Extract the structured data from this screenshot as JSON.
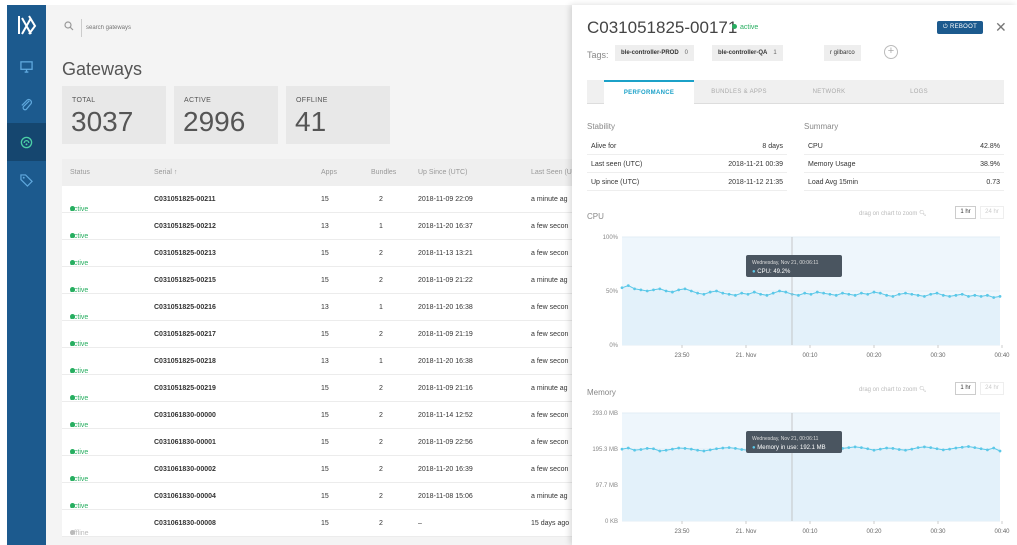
{
  "sidebar": {
    "logo": "logo-icon",
    "items": [
      {
        "icon": "monitor-icon",
        "active": false
      },
      {
        "icon": "paperclip-icon",
        "active": false
      },
      {
        "icon": "gateway-icon",
        "active": true
      },
      {
        "icon": "tag-icon",
        "active": false
      }
    ]
  },
  "search": {
    "placeholder": "search gateways",
    "value": ""
  },
  "page": {
    "title": "Gateways"
  },
  "stats": [
    {
      "label": "TOTAL",
      "value": "3037"
    },
    {
      "label": "ACTIVE",
      "value": "2996"
    },
    {
      "label": "OFFLINE",
      "value": "41"
    }
  ],
  "table": {
    "headers": {
      "status": "Status",
      "serial": "Serial ↑",
      "apps": "Apps",
      "bundles": "Bundles",
      "up_since": "Up Since (UTC)",
      "last_seen": "Last Seen (U"
    },
    "rows": [
      {
        "status": "active",
        "serial": "C031051825-00211",
        "apps": "15",
        "bundles": "2",
        "up_since": "2018-11-09 22:09",
        "last_seen": "a minute ag"
      },
      {
        "status": "active",
        "serial": "C031051825-00212",
        "apps": "13",
        "bundles": "1",
        "up_since": "2018-11-20 16:37",
        "last_seen": "a few secon"
      },
      {
        "status": "active",
        "serial": "C031051825-00213",
        "apps": "15",
        "bundles": "2",
        "up_since": "2018-11-13 13:21",
        "last_seen": "a few secon"
      },
      {
        "status": "active",
        "serial": "C031051825-00215",
        "apps": "15",
        "bundles": "2",
        "up_since": "2018-11-09 21:22",
        "last_seen": "a minute ag"
      },
      {
        "status": "active",
        "serial": "C031051825-00216",
        "apps": "13",
        "bundles": "1",
        "up_since": "2018-11-20 16:38",
        "last_seen": "a few secon"
      },
      {
        "status": "active",
        "serial": "C031051825-00217",
        "apps": "15",
        "bundles": "2",
        "up_since": "2018-11-09 21:19",
        "last_seen": "a few secon"
      },
      {
        "status": "active",
        "serial": "C031051825-00218",
        "apps": "13",
        "bundles": "1",
        "up_since": "2018-11-20 16:38",
        "last_seen": "a few secon"
      },
      {
        "status": "active",
        "serial": "C031051825-00219",
        "apps": "15",
        "bundles": "2",
        "up_since": "2018-11-09 21:16",
        "last_seen": "a minute ag"
      },
      {
        "status": "active",
        "serial": "C031061830-00000",
        "apps": "15",
        "bundles": "2",
        "up_since": "2018-11-14 12:52",
        "last_seen": "a few secon"
      },
      {
        "status": "active",
        "serial": "C031061830-00001",
        "apps": "15",
        "bundles": "2",
        "up_since": "2018-11-09 22:56",
        "last_seen": "a few secon"
      },
      {
        "status": "active",
        "serial": "C031061830-00002",
        "apps": "15",
        "bundles": "2",
        "up_since": "2018-11-20 16:39",
        "last_seen": "a few secon"
      },
      {
        "status": "active",
        "serial": "C031061830-00004",
        "apps": "15",
        "bundles": "2",
        "up_since": "2018-11-08 15:06",
        "last_seen": "a minute ag"
      },
      {
        "status": "offline",
        "serial": "C031061830-00008",
        "apps": "15",
        "bundles": "2",
        "up_since": "–",
        "last_seen": "15 days ago"
      }
    ]
  },
  "detail": {
    "title": "C031051825-00171",
    "status": "active",
    "reboot_label": "REBOOT",
    "close_icon": "close-icon",
    "tags_label": "Tags:",
    "tags": [
      {
        "name": "ble-controller-PROD",
        "count": "0"
      },
      {
        "name": "ble-controller-QA",
        "count": "1"
      },
      {
        "name": "r  gilbarco",
        "count": ""
      }
    ],
    "tabs": [
      "PERFORMANCE",
      "BUNDLES & APPS",
      "NETWORK",
      "LOGS"
    ],
    "active_tab": "PERFORMANCE",
    "stability": {
      "label": "Stability",
      "rows": [
        {
          "k": "Alive for",
          "v": "8 days"
        },
        {
          "k": "Last seen (UTC)",
          "v": "2018-11-21 00:39"
        },
        {
          "k": "Up since (UTC)",
          "v": "2018-11-12 21:35"
        }
      ]
    },
    "summary": {
      "label": "Summary",
      "rows": [
        {
          "k": "CPU",
          "v": "42.8%"
        },
        {
          "k": "Memory Usage",
          "v": "38.9%"
        },
        {
          "k": "Load Avg 15min",
          "v": "0.73"
        }
      ]
    },
    "zoom_hint": "drag on chart to zoom",
    "range_buttons": [
      "1 hr",
      "24 hr"
    ]
  },
  "colors": {
    "sidebar": "#1c5a8e",
    "accent": "#1ba1c8",
    "active": "#27ae60"
  },
  "chart_data": [
    {
      "type": "line",
      "title": "CPU",
      "x_ticks": [
        "23:50",
        "21. Nov",
        "00:10",
        "00:20",
        "00:30",
        "00:40"
      ],
      "y_ticks": [
        "100%",
        "50%",
        "0%"
      ],
      "ylim": [
        0,
        100
      ],
      "tooltip": {
        "time": "Wednesday, Nov 21, 00:06:11",
        "series": "CPU",
        "value": "49.2%"
      },
      "series": [
        {
          "name": "CPU",
          "values": [
            53,
            55,
            52,
            51,
            50,
            51,
            52,
            50,
            49,
            51,
            52,
            50,
            48,
            47,
            49,
            50,
            48,
            47,
            46,
            48,
            47,
            49,
            47,
            46,
            48,
            50,
            49,
            47,
            46,
            48,
            47,
            49,
            48,
            47,
            46,
            48,
            47,
            46,
            48,
            47,
            49,
            48,
            46,
            45,
            47,
            48,
            47,
            46,
            45,
            47,
            48,
            46,
            45,
            46,
            47,
            45,
            46,
            45,
            46,
            44,
            45
          ]
        }
      ]
    },
    {
      "type": "line",
      "title": "Memory",
      "x_ticks": [
        "23:50",
        "21. Nov",
        "00:10",
        "00:20",
        "00:30",
        "00:40"
      ],
      "y_ticks": [
        "293.0 MB",
        "195.3 MB",
        "97.7 MB",
        "0 KB"
      ],
      "ylim": [
        0,
        293
      ],
      "tooltip": {
        "time": "Wednesday, Nov 21, 00:06:11",
        "series": "Memory in use",
        "value": "192.1 MB"
      },
      "series": [
        {
          "name": "Memory in use",
          "values": [
            195,
            198,
            192,
            194,
            197,
            196,
            190,
            192,
            195,
            198,
            197,
            195,
            192,
            190,
            193,
            196,
            198,
            199,
            197,
            194,
            192,
            195,
            198,
            200,
            199,
            196,
            193,
            195,
            198,
            200,
            202,
            198,
            195,
            192,
            194,
            197,
            199,
            201,
            199,
            196,
            192,
            195,
            198,
            197,
            194,
            192,
            195,
            199,
            201,
            199,
            196,
            193,
            195,
            198,
            200,
            202,
            199,
            196,
            193,
            198,
            190
          ]
        }
      ]
    }
  ]
}
